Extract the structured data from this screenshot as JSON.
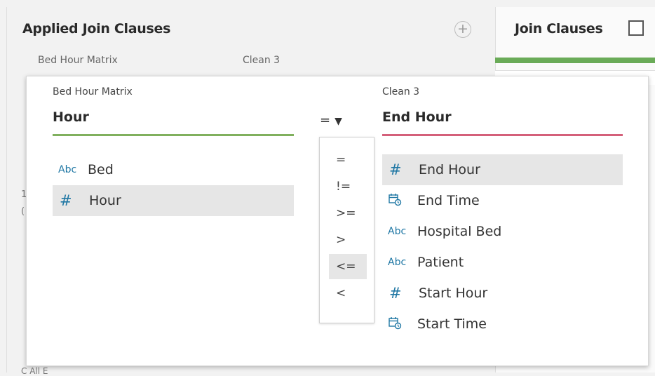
{
  "left_panel": {
    "title": "Applied Join Clauses",
    "left_source": "Bed Hour Matrix",
    "right_source": "Clean 3",
    "add_icon": "plus-icon",
    "fragment_1": "1",
    "fragment_2": "(",
    "bottom_fragment": "C           All     E"
  },
  "right_panel": {
    "title": "Join Clauses",
    "checkbox_checked": false
  },
  "popup": {
    "left": {
      "source": "Bed Hour Matrix",
      "selected_field": "Hour",
      "underline_color": "#80b05e",
      "fields": [
        {
          "type": "Abc",
          "name": "Bed",
          "selected": false
        },
        {
          "type": "#",
          "name": "Hour",
          "selected": true
        }
      ]
    },
    "operator": {
      "current": "=",
      "icon": "caret-down-icon",
      "options": [
        "=",
        "!=",
        ">=",
        ">",
        "<=",
        "<"
      ],
      "highlighted": "<="
    },
    "right": {
      "source": "Clean 3",
      "selected_field": "End Hour",
      "underline_color": "#d4607a",
      "fields": [
        {
          "type": "#",
          "name": "End Hour",
          "selected": true
        },
        {
          "type": "datetime",
          "name": "End Time",
          "selected": false
        },
        {
          "type": "Abc",
          "name": "Hospital Bed",
          "selected": false
        },
        {
          "type": "Abc",
          "name": "Patient",
          "selected": false
        },
        {
          "type": "#",
          "name": "Start Hour",
          "selected": false
        },
        {
          "type": "datetime",
          "name": "Start Time",
          "selected": false
        }
      ]
    }
  },
  "icons": {
    "abc": "Abc",
    "number": "#"
  },
  "colors": {
    "accent_green": "#6aab58",
    "left_underline": "#80b05e",
    "right_underline": "#d4607a",
    "type_icon": "#1f77a4"
  }
}
